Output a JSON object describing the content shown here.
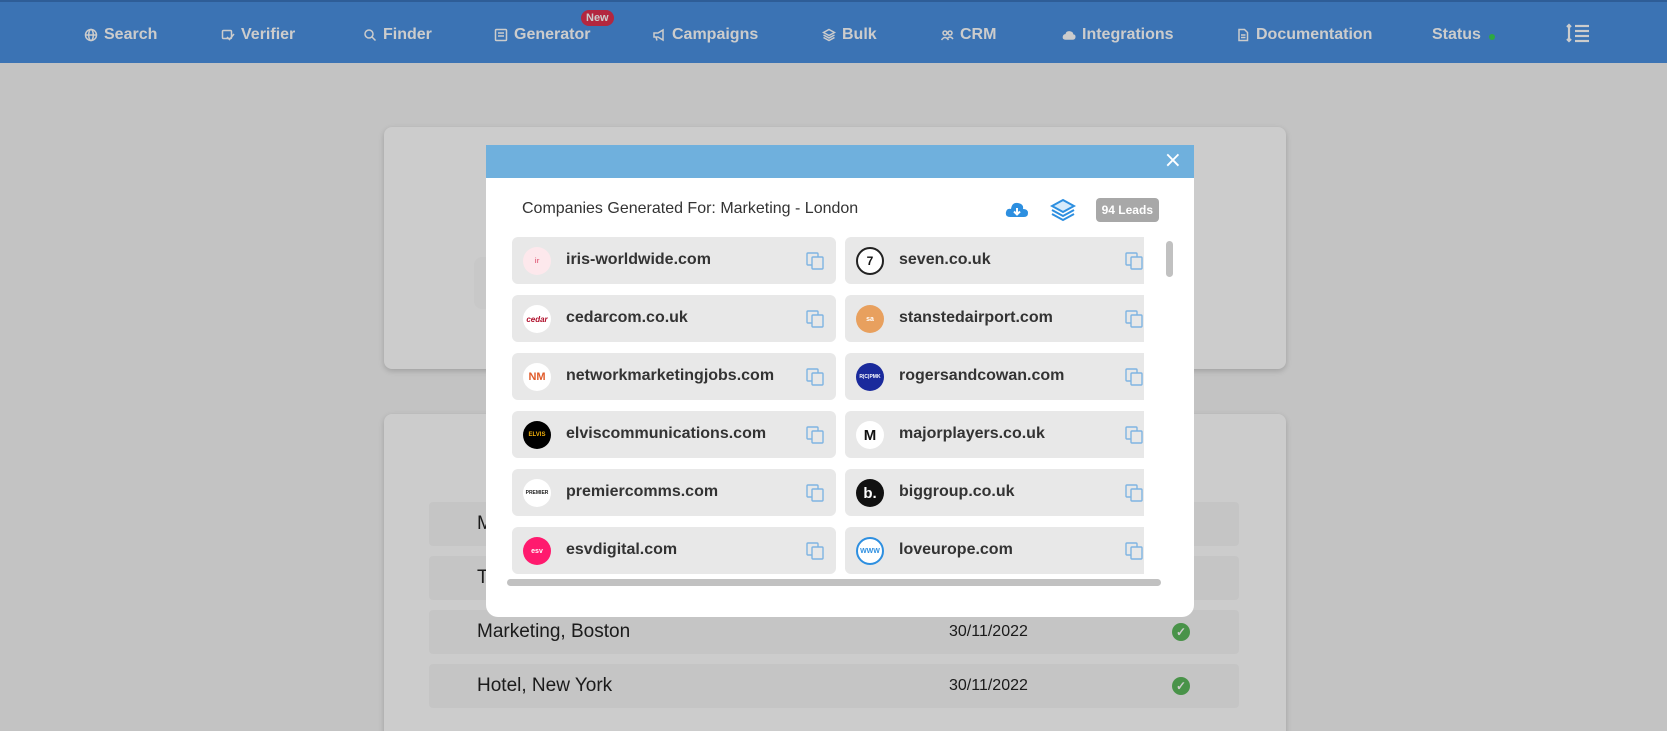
{
  "nav": {
    "items": [
      {
        "label": "Search",
        "icon": "globe-icon"
      },
      {
        "label": "Verifier",
        "icon": "verify-icon"
      },
      {
        "label": "Finder",
        "icon": "search-icon"
      },
      {
        "label": "Generator",
        "icon": "generator-icon"
      },
      {
        "label": "Campaigns",
        "icon": "megaphone-icon"
      },
      {
        "label": "Bulk",
        "icon": "layers-icon"
      },
      {
        "label": "CRM",
        "icon": "users-icon"
      },
      {
        "label": "Integrations",
        "icon": "cloud-icon"
      },
      {
        "label": "Documentation",
        "icon": "document-icon"
      },
      {
        "label": "Status",
        "icon": "status-dot"
      }
    ],
    "new_badge": "New",
    "menu_icon": "sort-lines-icon"
  },
  "history": {
    "rows": [
      {
        "name": "Marketing, Boston",
        "date": "30/11/2022"
      },
      {
        "name": "Hotel, New York",
        "date": "30/11/2022"
      }
    ],
    "partial_rows": [
      "M",
      "T"
    ]
  },
  "modal": {
    "close": "×",
    "title": "Companies Generated For: Marketing - London",
    "leads_badge": "94 Leads",
    "download_icon": "cloud-download-icon",
    "bulk_icon": "layers-icon",
    "companies": [
      {
        "domain": "iris-worldwide.com",
        "logo": "ir"
      },
      {
        "domain": "seven.co.uk",
        "logo": "7"
      },
      {
        "domain": "cedarcom.co.uk",
        "logo": "cedar"
      },
      {
        "domain": "stanstedairport.com",
        "logo": "sa"
      },
      {
        "domain": "networkmarketingjobs.com",
        "logo": "NM"
      },
      {
        "domain": "rogersandcowan.com",
        "logo": "R|C|PMK"
      },
      {
        "domain": "elviscommunications.com",
        "logo": "ELVIS"
      },
      {
        "domain": "majorplayers.co.uk",
        "logo": "M"
      },
      {
        "domain": "premiercomms.com",
        "logo": "PREMIER"
      },
      {
        "domain": "biggroup.co.uk",
        "logo": "b."
      },
      {
        "domain": "esvdigital.com",
        "logo": "esv"
      },
      {
        "domain": "loveurope.com",
        "logo": "WWW"
      }
    ]
  },
  "colors": {
    "nav_bg": "#4a90e2",
    "modal_header": "#6fb0dd",
    "accent_blue": "#2d8fe0"
  }
}
